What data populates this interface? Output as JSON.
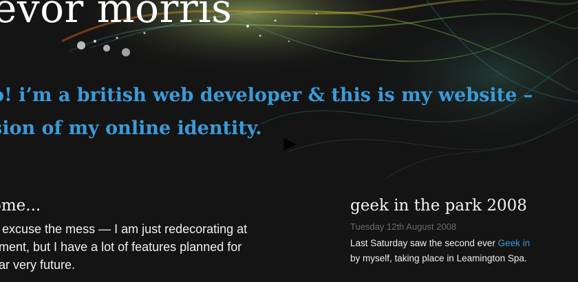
{
  "site": {
    "title": "evor morris"
  },
  "intro": {
    "line1": "o! i’m a british web developer & this is my website –",
    "line2": "sion of my online identity."
  },
  "welcome": {
    "heading": "ome...",
    "body_line1": "e excuse the mess — I am just redecorating at",
    "body_line2": "oment, but I have a lot of features planned for",
    "body_line3": "ear very future."
  },
  "latest_post": {
    "title": "geek in the park 2008",
    "date": "Tuesday 12th August 2008",
    "text_before_link": "Last Saturday saw the second ever ",
    "link_text": "Geek in",
    "text_line2": "by myself, taking place in Leamington Spa."
  },
  "colors": {
    "background": "#141414",
    "accent_blue": "#3a9bd9",
    "date_grey": "#6b6b6b"
  }
}
